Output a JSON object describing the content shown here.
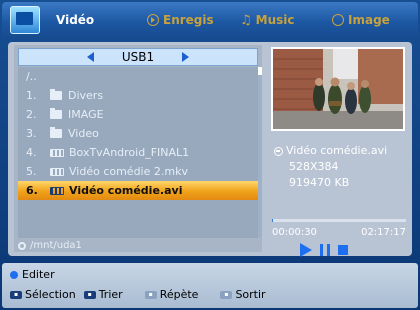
{
  "tabs": [
    {
      "label": "Vidéo",
      "active": true
    },
    {
      "label": "Enregis",
      "active": false
    },
    {
      "label": "Music",
      "active": false
    },
    {
      "label": "Image",
      "active": false
    }
  ],
  "browser": {
    "device": "USB1",
    "up_dir": "/..",
    "items": [
      {
        "num": "1.",
        "name": "Divers",
        "type": "folder"
      },
      {
        "num": "2.",
        "name": "IMAGE",
        "type": "folder"
      },
      {
        "num": "3.",
        "name": "Video",
        "type": "folder"
      },
      {
        "num": "4.",
        "name": "BoxTvAndroid_FINAL1",
        "type": "video"
      },
      {
        "num": "5.",
        "name": "Vidéo comédie 2.mkv",
        "type": "video"
      },
      {
        "num": "6.",
        "name": "Vidéo comédie.avi",
        "type": "video",
        "selected": true
      }
    ],
    "path": "/mnt/uda1"
  },
  "file_info": {
    "name": "Vidéo comédie.avi",
    "resolution": "528X384",
    "size": "919470 KB"
  },
  "playback": {
    "elapsed": "00:00:30",
    "duration": "02:17:17",
    "progress_fraction": 0.004
  },
  "footer": {
    "edit_label": "Editer",
    "select_label": "Sélection",
    "sort_label": "Trier",
    "repeat_label": "Répète",
    "exit_label": "Sortir"
  },
  "colors": {
    "accent": "#1e6ff0",
    "selected_row": "#f0a21a",
    "inactive_tab_text": "#c7a23d"
  }
}
